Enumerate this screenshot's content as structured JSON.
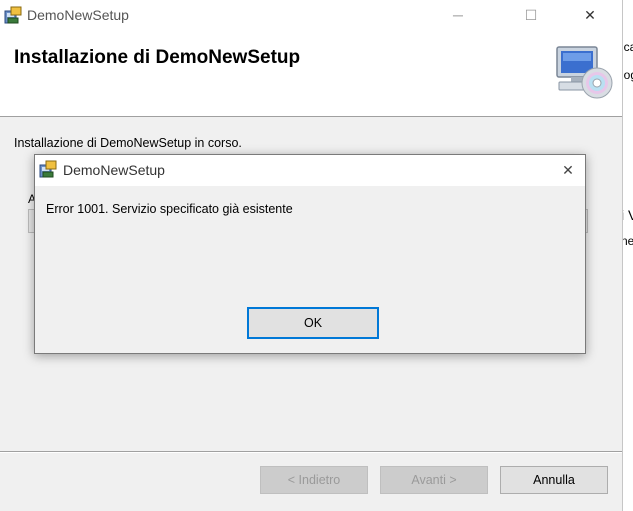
{
  "installer": {
    "title": "DemoNewSetup",
    "banner_title": "Installazione di DemoNewSetup",
    "status_text": "Installazione di DemoNewSetup in corso.",
    "partial_label": "A",
    "progress_fraction": 0.0,
    "buttons": {
      "back": "< Indietro",
      "next": "Avanti >",
      "cancel": "Annulla"
    },
    "caption": {
      "minimize": "─",
      "maximize": "☐",
      "close": "✕"
    }
  },
  "background_window": {
    "fragments": [
      "ica",
      "log",
      "i V",
      "ne"
    ]
  },
  "dialog": {
    "title": "DemoNewSetup",
    "message": "Error 1001. Servizio specificato già esistente",
    "ok_label": "OK",
    "close_glyph": "✕"
  },
  "icons": {
    "app": "installer-package-icon",
    "banner": "computer-cd-icon"
  }
}
